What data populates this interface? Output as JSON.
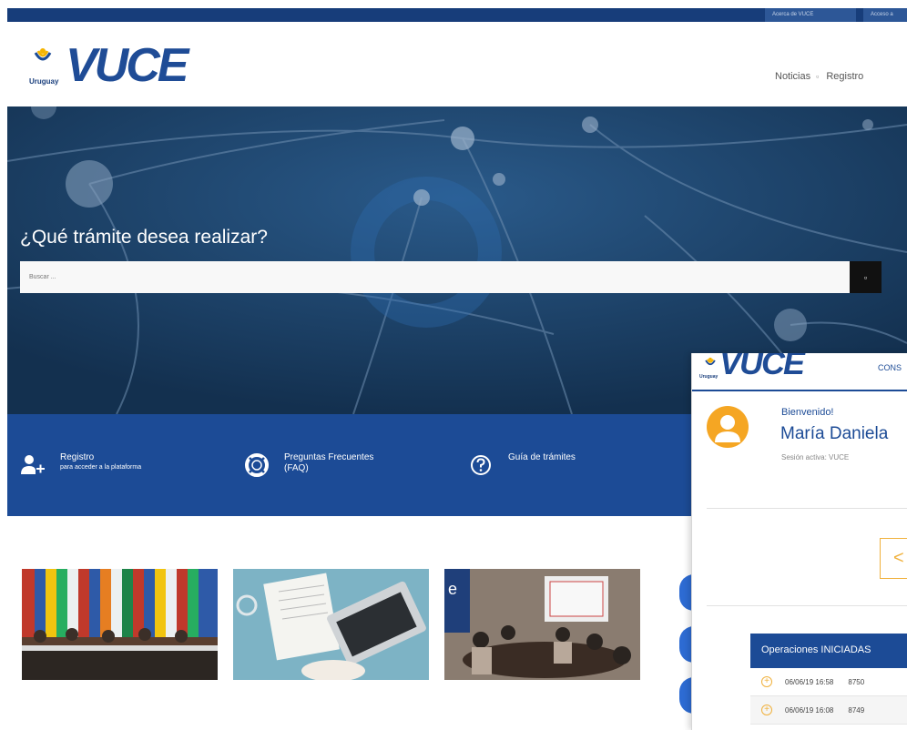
{
  "topbar": {
    "link1": "Acerca de VUCE",
    "link2": "Acceso a"
  },
  "header": {
    "logo_country": "Uruguay",
    "logo_text": "VUCE",
    "nav": [
      {
        "label": "Noticias",
        "icon": "rss-icon"
      },
      {
        "label": "Registro"
      }
    ]
  },
  "hero": {
    "title": "¿Qué trámite desea realizar?",
    "search_placeholder": "Buscar ...",
    "search_icon": "search-icon"
  },
  "features": [
    {
      "title": "Registro",
      "subtitle": "para acceder a la plataforma",
      "icon": "user-add-icon"
    },
    {
      "title": "Preguntas Frecuentes",
      "subtitle": "(FAQ)",
      "icon": "lifebuoy-icon"
    },
    {
      "title": "Guía de trámites",
      "subtitle": "",
      "icon": "question-circle-icon"
    }
  ],
  "photos": [
    {
      "name": "photo-conference-flags"
    },
    {
      "name": "photo-desk-laptop"
    },
    {
      "name": "photo-meeting-room"
    }
  ],
  "panel": {
    "logo_country": "Uruguay",
    "logo_text": "VUCE",
    "nav_label": "CONS",
    "welcome": "Bienvenido!",
    "user_name": "María Daniela",
    "session": "Sesión activa: VUCE",
    "operations": {
      "title": "Operaciones INICIADAS",
      "rows": [
        {
          "date": "06/06/19 16:58",
          "id": "8750"
        },
        {
          "date": "06/06/19 16:08",
          "id": "8749"
        }
      ]
    }
  },
  "colors": {
    "primary": "#1c4b96",
    "dark_navy": "#16375f",
    "accent": "#f5a623"
  }
}
